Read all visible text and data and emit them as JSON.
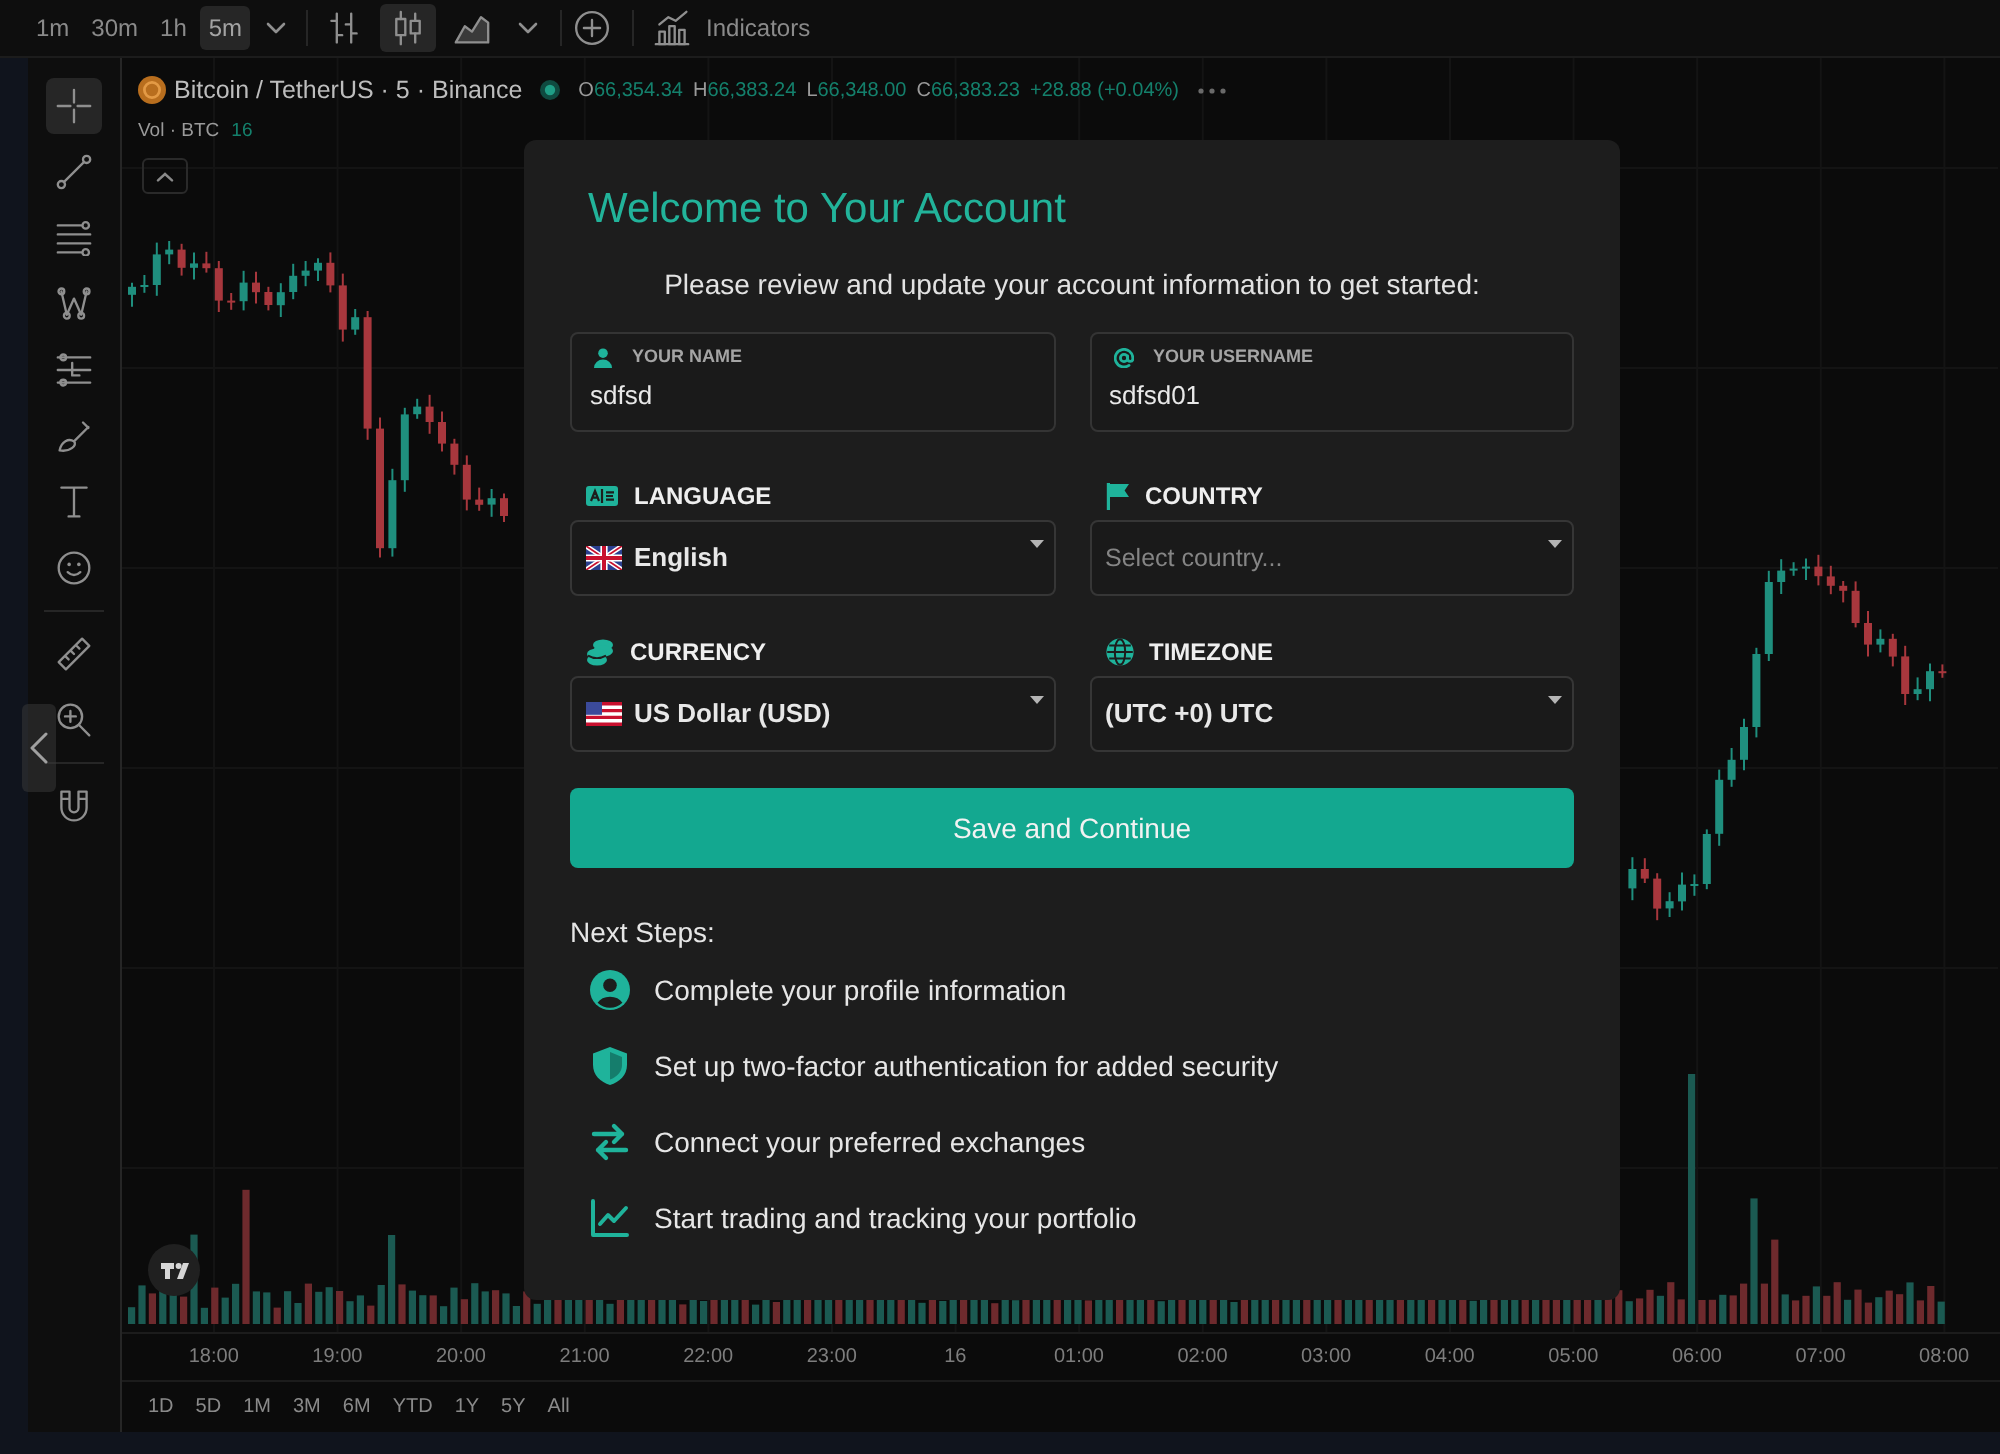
{
  "toolbar": {
    "intervals": [
      {
        "label": "1m",
        "selected": false
      },
      {
        "label": "30m",
        "selected": false
      },
      {
        "label": "1h",
        "selected": false
      },
      {
        "label": "5m",
        "selected": true
      }
    ],
    "chart_types": [
      {
        "kind": "bars",
        "selected": false
      },
      {
        "kind": "candles",
        "selected": true
      },
      {
        "kind": "area",
        "selected": false
      }
    ],
    "indicators": "Indicators"
  },
  "drawing_tool_groups": [
    {
      "tools": [
        {
          "kind": "crosshair",
          "selected": true
        },
        {
          "kind": "trend_line",
          "selected": false
        },
        {
          "kind": "parallel_lines",
          "selected": false
        },
        {
          "kind": "pattern",
          "selected": false
        },
        {
          "kind": "levels",
          "selected": false
        },
        {
          "kind": "brush",
          "selected": false
        },
        {
          "kind": "text",
          "selected": false
        },
        {
          "kind": "emoji",
          "selected": false
        }
      ]
    },
    {
      "tools": [
        {
          "kind": "ruler",
          "selected": false
        },
        {
          "kind": "zoom",
          "selected": false
        }
      ]
    },
    {
      "tools": [
        {
          "kind": "magnet",
          "selected": false
        }
      ]
    }
  ],
  "legend": {
    "symbol": "Bitcoin / TetherUS · 5 · Binance",
    "ohlc": [
      {
        "key": "O",
        "value": "66,354.34"
      },
      {
        "key": "H",
        "value": "66,383.24"
      },
      {
        "key": "L",
        "value": "66,348.00"
      },
      {
        "key": "C",
        "value": "66,383.23"
      }
    ],
    "change": "+28.88 (+0.04%)",
    "volume_label": "Vol · BTC",
    "volume_value": "16"
  },
  "time_axis": [
    "18:00",
    "19:00",
    "20:00",
    "21:00",
    "22:00",
    "23:00",
    "16",
    "01:00",
    "02:00",
    "03:00",
    "04:00",
    "05:00",
    "06:00",
    "07:00",
    "08:00"
  ],
  "ranges": [
    "1D",
    "5D",
    "1M",
    "3M",
    "6M",
    "YTD",
    "1Y",
    "5Y",
    "All"
  ],
  "modal": {
    "title": "Welcome to Your Account",
    "subtitle": "Please review and update your account information to get started:",
    "text_fields": [
      {
        "kind": "name",
        "label": "YOUR NAME",
        "value": "sdfsd"
      },
      {
        "kind": "username",
        "label": "YOUR USERNAME",
        "value": "sdfsd01"
      }
    ],
    "selects": [
      {
        "kind": "language",
        "label": "LANGUAGE",
        "value": "English"
      },
      {
        "kind": "country",
        "label": "COUNTRY",
        "placeholder": "Select country..."
      },
      {
        "kind": "currency",
        "label": "CURRENCY",
        "value": "US Dollar (USD)"
      },
      {
        "kind": "timezone",
        "label": "TIMEZONE",
        "value": "(UTC +0) UTC"
      }
    ],
    "submit": "Save and Continue",
    "next_steps_title": "Next Steps:",
    "next_steps": [
      {
        "kind": "profile",
        "text": "Complete your profile information"
      },
      {
        "kind": "security",
        "text": "Set up two-factor authentication for added security"
      },
      {
        "kind": "exchanges",
        "text": "Connect your preferred exchanges"
      },
      {
        "kind": "trading",
        "text": "Start trading and tracking your portfolio"
      }
    ]
  }
}
